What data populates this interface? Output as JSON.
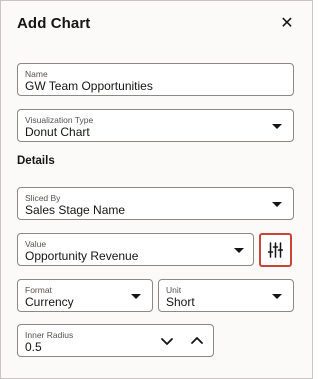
{
  "dialog": {
    "title": "Add Chart",
    "close_icon": "close-icon"
  },
  "name_field": {
    "label": "Name",
    "value": "GW Team Opportunities"
  },
  "visualization_field": {
    "label": "Visualization Type",
    "value": "Donut Chart"
  },
  "details": {
    "heading": "Details"
  },
  "sliced_by_field": {
    "label": "Sliced By",
    "value": "Sales Stage Name"
  },
  "value_field": {
    "label": "Value",
    "value": "Opportunity Revenue"
  },
  "format_field": {
    "label": "Format",
    "value": "Currency"
  },
  "unit_field": {
    "label": "Unit",
    "value": "Short"
  },
  "inner_radius_field": {
    "label": "Inner Radius",
    "value": "0.5"
  },
  "icons": {
    "dropdown": "chevron-down-icon",
    "settings": "sliders-icon",
    "decrement": "chevron-down-icon",
    "increment": "chevron-up-icon"
  },
  "colors": {
    "focus_border": "#c74634",
    "background": "#fbfaf8"
  }
}
